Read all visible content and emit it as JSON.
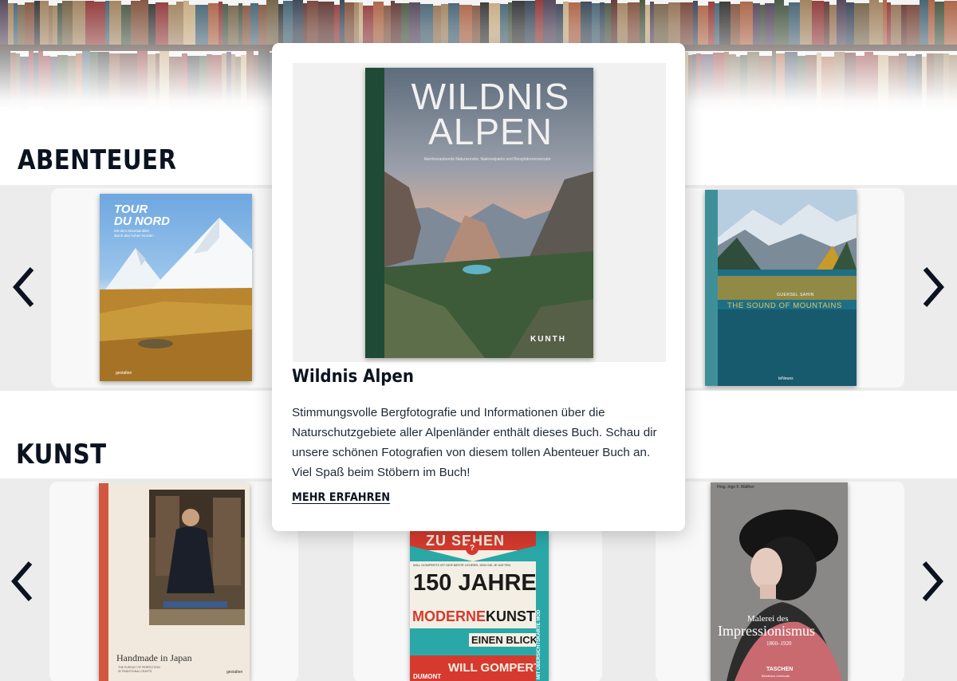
{
  "sections": [
    {
      "title": "ABENTEUER"
    },
    {
      "title": "KUNST"
    }
  ],
  "navigation": {
    "prev_icon": "chevron-left-icon",
    "next_icon": "chevron-right-icon"
  },
  "books": {
    "tour_du_nord": {
      "title": "TOUR DU NORD",
      "title_line1": "TOUR",
      "title_line2": "DU NORD",
      "subtitle_line1": "Mit dem Mountainbike",
      "subtitle_line2": "durch den hohen Norden",
      "publisher": "gestalten"
    },
    "sound_of_mountains": {
      "author": "GUERSEL SAHIN",
      "title": "THE SOUND OF MOUNTAINS",
      "publisher": "teNeues"
    },
    "handmade_in_japan": {
      "title": "Handmade in Japan",
      "subtitle_line1": "THE PURSUIT OF PERFECTION",
      "subtitle_line2": "IN TRADITIONAL CRAFTS",
      "publisher": "gestalten"
    },
    "150_jahre_moderne_kunst": {
      "top": "ZU SEHEN",
      "quote": "WILL GOMPERTZ IST DER BESTE LEHRER, DEN SIE JE HATTEN",
      "line1": "150 JAHRE",
      "line2_a": "MODERNE",
      "line2_b": "KUNST",
      "line3": "EINEN BLICK",
      "author": "WILL GOMPERTZ",
      "publisher": "DUMONT",
      "side_badge": "MIT ÜBERSICHTSKARTE MOD"
    },
    "impressionismus": {
      "editor": "Hrsg. Ingo F. Walther",
      "title_line1": "Malerei des",
      "title_line2": "Impressionismus",
      "years": "1860–1920",
      "publisher": "TASCHEN",
      "series": "Bibliotheca Universalis"
    }
  },
  "popup": {
    "cover_title_line1": "WILDNIS",
    "cover_title_line2": "ALPEN",
    "cover_subtitle": "Atemberaubende Naturwunder, Nationalparks und Biosphärenreservate",
    "cover_publisher": "KUNTH",
    "title": "Wildnis Alpen",
    "description": "Stimmungsvolle Bergfotografie und Informationen über die Naturschutzgebiete aller Alpenländer enthält dieses Buch. Schau dir unsere schönen Fotografien von diesem tollen Abenteuer Buch an. Viel Spaß beim Stöbern im Buch!",
    "link_label": "MEHR ERFAHREN"
  },
  "colors": {
    "heading": "#0b1220",
    "band_white": "#ffffff",
    "carousel_band": "#ececec",
    "card": "#f8f8f8"
  }
}
